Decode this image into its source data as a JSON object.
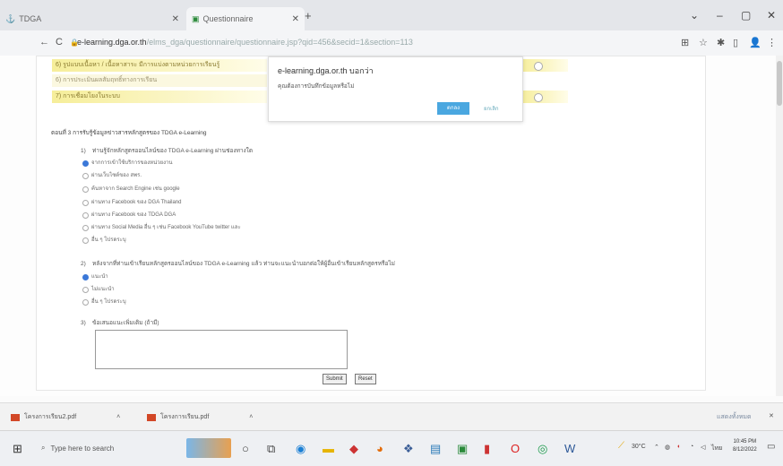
{
  "browser": {
    "tabs": [
      {
        "label": "TDGA"
      },
      {
        "label": "Questionnaire"
      }
    ],
    "window_controls": [
      "⌄",
      "–",
      "▢",
      "✕"
    ],
    "url_host": "e-learning.dga.or.th",
    "url_path": "/elms_dga/questionnaire/questionnaire.jsp?qid=456&secid=1&section=113"
  },
  "page": {
    "yellow_rows": [
      "6) รูปแบบเนื้อหา / เนื้อหาสาระ มีการแบ่งตามหน่วยการเรียนรู้",
      "6) การประเมินผลสัมฤทธิ์ทางการเรียน",
      "7) การเชื่อมโยงในระบบ"
    ],
    "dialog": {
      "title": "e-learning.dga.or.th บอกว่า",
      "message": "คุณต้องการบันทึกข้อมูลหรือไม่",
      "ok": "ตกลง",
      "cancel": "ยกเลิก"
    },
    "section_title": "ตอนที่ 3 การรับรู้ข้อมูลข่าวสารหลักสูตรของ TDGA e-Learning",
    "q1": {
      "number": "1)",
      "text": "ท่านรู้จักหลักสูตรออนไลน์ของ TDGA e-Learning ผ่านช่องทางใด",
      "options": [
        "จากการเข้าใช้บริการของหน่วยงาน",
        "ผ่านเว็บไซต์ของ สพร.",
        "ค้นหาจาก Search Engine เช่น google",
        "ผ่านทาง Facebook ของ DGA Thailand",
        "ผ่านทาง Facebook ของ TDGA DGA",
        "ผ่านทาง Social Media อื่น ๆ เช่น Facebook YouTube twitter และ",
        "อื่น ๆ โปรดระบุ"
      ]
    },
    "q2": {
      "number": "2)",
      "text": "หลังจากที่ท่านเข้าเรียนหลักสูตรออนไลน์ของ TDGA e-Learning แล้ว ท่านจะแนะนำบอกต่อให้ผู้อื่นเข้าเรียนหลักสูตรหรือไม่",
      "options": [
        "แนะนำ",
        "ไม่แนะนำ",
        "อื่น ๆ โปรดระบุ"
      ]
    },
    "q3": {
      "number": "3)",
      "text": "ข้อเสนอแนะเพิ่มเติม (ถ้ามี)"
    },
    "submit": "Submit",
    "reset": "Reset"
  },
  "downloads": [
    {
      "name": "โครงการเรียน2.pdf"
    },
    {
      "name": "โครงการเรียน.pdf"
    }
  ],
  "downloads_show_all": "แสดงทั้งหมด",
  "taskbar": {
    "search_placeholder": "Type here to search",
    "temperature": "30°C",
    "language": "ไทย",
    "time": "10:45 PM",
    "date": "8/12/2022"
  },
  "colors": {
    "accent": "#3b78d8",
    "ok_button": "#4aa7e0",
    "yellow": "#f6ee9a"
  }
}
